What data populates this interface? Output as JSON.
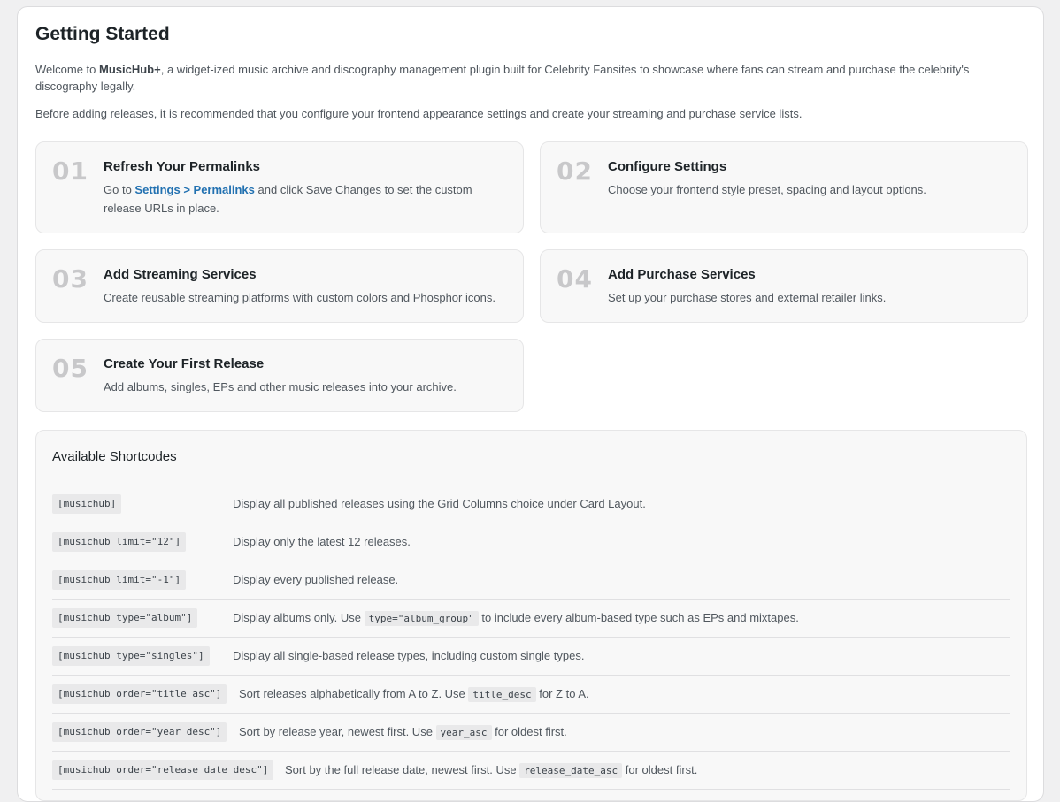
{
  "page": {
    "title": "Getting Started",
    "intro_prefix": "Welcome to ",
    "intro_brand": "MusicHub+",
    "intro_suffix": ", a widget-ized music archive and discography management plugin built for Celebrity Fansites to showcase where fans can stream and purchase the celebrity's discography legally.",
    "intro2": "Before adding releases, it is recommended that you configure your frontend appearance settings and create your streaming and purchase service lists."
  },
  "steps": [
    {
      "num": "01",
      "title": "Refresh Your Permalinks",
      "desc_prefix": "Go to ",
      "link": "Settings > Permalinks",
      "desc_suffix": " and click Save Changes to set the custom release URLs in place."
    },
    {
      "num": "02",
      "title": "Configure Settings",
      "desc": "Choose your frontend style preset, spacing and layout options."
    },
    {
      "num": "03",
      "title": "Add Streaming Services",
      "desc": "Create reusable streaming platforms with custom colors and Phosphor icons."
    },
    {
      "num": "04",
      "title": "Add Purchase Services",
      "desc": "Set up your purchase stores and external retailer links."
    },
    {
      "num": "05",
      "title": "Create Your First Release",
      "desc": "Add albums, singles, EPs and other music releases into your archive."
    }
  ],
  "shortcodes": {
    "title": "Available Shortcodes",
    "rows": [
      {
        "code": "[musichub]",
        "desc": "Display all published releases using the Grid Columns choice under Card Layout."
      },
      {
        "code": "[musichub limit=\"12\"]",
        "desc": "Display only the latest 12 releases."
      },
      {
        "code": "[musichub limit=\"-1\"]",
        "desc": "Display every published release."
      },
      {
        "code": "[musichub type=\"album\"]",
        "desc_a": "Display albums only. Use ",
        "inline": "type=\"album_group\"",
        "desc_b": " to include every album-based type such as EPs and mixtapes."
      },
      {
        "code": "[musichub type=\"singles\"]",
        "desc": "Display all single-based release types, including custom single types."
      },
      {
        "code": "[musichub order=\"title_asc\"]",
        "desc_a": "Sort releases alphabetically from A to Z. Use ",
        "inline": "title_desc",
        "desc_b": " for Z to A."
      },
      {
        "code": "[musichub order=\"year_desc\"]",
        "desc_a": "Sort by release year, newest first. Use ",
        "inline": "year_asc",
        "desc_b": " for oldest first."
      },
      {
        "code": "[musichub order=\"release_date_desc\"]",
        "desc_a": "Sort by the full release date, newest first. Use ",
        "inline": "release_date_asc",
        "desc_b": " for oldest first."
      }
    ]
  }
}
